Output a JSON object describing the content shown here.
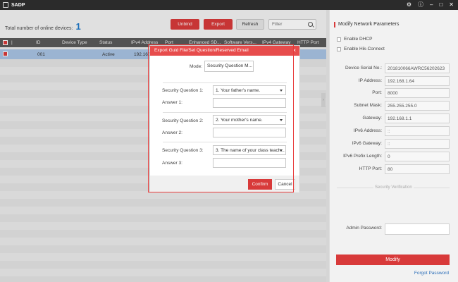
{
  "app": {
    "title": "SADP"
  },
  "window_controls": {
    "settings": "⚙",
    "info": "ⓘ",
    "minimize": "–",
    "maximize": "□",
    "close": "✕"
  },
  "toolbar": {
    "total_label": "Total number of online devices:",
    "total_count": "1",
    "unbind_label": "Unbind",
    "export_label": "Export",
    "refresh_label": "Refresh",
    "filter_placeholder": "Filter"
  },
  "table": {
    "columns": [
      "ID",
      "Device Type",
      "Status",
      "IPv4 Address",
      "Port",
      "Enhanced SD...",
      "Software Vers...",
      "IPv4 Gateway",
      "HTTP Port"
    ],
    "rows": [
      {
        "id": "001",
        "status": "Active",
        "ipv4": "192.168"
      }
    ]
  },
  "dialog": {
    "title": "Export Guid File/Set Question/Reserved Email",
    "close": "×",
    "mode_label": "Mode:",
    "mode_value": "Security Question M...",
    "q1_label": "Security Question 1:",
    "q1_value": "1. Your father's name.",
    "a1_label": "Answer 1:",
    "q2_label": "Security Question 2:",
    "q2_value": "2. Your mother's name.",
    "a2_label": "Answer 2:",
    "q3_label": "Security Question 3:",
    "q3_value": "3. The name of your class teach...",
    "a3_label": "Answer 3:",
    "confirm_label": "Confirm",
    "cancel_label": "Cancel"
  },
  "right_panel": {
    "title": "Modify Network Parameters",
    "enable_dhcp": "Enable DHCP",
    "enable_hik": "Enable Hik-Connect",
    "serial_label": "Device Serial No.:",
    "serial_value": "201810066AWRC56202623",
    "ip_label": "IP Address:",
    "ip_value": "192.168.1.64",
    "port_label": "Port:",
    "port_value": "8000",
    "mask_label": "Subnet Mask:",
    "mask_value": "255.255.255.0",
    "gateway_label": "Gateway:",
    "gateway_value": "192.168.1.1",
    "ipv6_label": "IPv6 Address:",
    "ipv6_value": "::",
    "ipv6gw_label": "IPv6 Gateway:",
    "ipv6gw_value": "::",
    "prefix_label": "IPv6 Prefix Length:",
    "prefix_value": "0",
    "http_label": "HTTP Port:",
    "http_value": "80",
    "security_section": "Security Verification",
    "admin_label": "Admin Password:",
    "modify_label": "Modify",
    "forgot_label": "Forgot Password"
  },
  "colors": {
    "accent": "#d83a3a",
    "link": "#2a6db8",
    "selected_row": "#a9c4e4"
  }
}
